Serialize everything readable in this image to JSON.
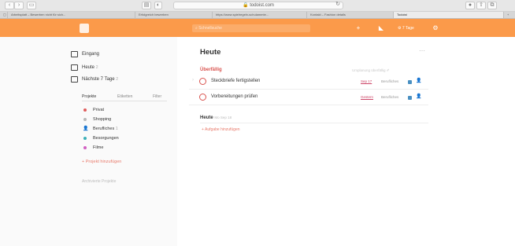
{
  "browser": {
    "url": "todoist.com",
    "tabs": [
      {
        "label": "Arbeitsplatt – Bewerben nicht für sich...",
        "active": false
      },
      {
        "label": "Erfolgreich bewerben",
        "active": false
      },
      {
        "label": "https://www.spielregeln-schulammte...",
        "active": false
      },
      {
        "label": "Kontakt – Fashion details",
        "active": false
      },
      {
        "label": "Todoist",
        "active": true
      }
    ]
  },
  "topbar": {
    "search_placeholder": "Schnellsuche",
    "karma_label": "7 Tage"
  },
  "sidebar": {
    "nav": [
      {
        "label": "Eingang",
        "icon": "inbox-icon"
      },
      {
        "label": "Heute",
        "count": "2",
        "icon": "calendar-today-icon"
      },
      {
        "label": "Nächste 7 Tage",
        "count": "2",
        "icon": "calendar-week-icon"
      }
    ],
    "tabs": [
      "Projekte",
      "Etiketten",
      "Filter"
    ],
    "projects": [
      {
        "label": "Privat",
        "color": "#e05d5d"
      },
      {
        "label": "Shopping",
        "color": "#b8b8b8"
      },
      {
        "label": "Berufliches",
        "count": "1",
        "color": "#4a90c2",
        "icon": "person-icon"
      },
      {
        "label": "Besorgungen",
        "color": "#3cb0b8"
      },
      {
        "label": "Filme",
        "color": "#d15fc2"
      }
    ],
    "add_project": "Projekt hinzufügen",
    "archived": "Archivierte Projekte"
  },
  "main": {
    "title": "Heute",
    "overdue_title": "Überfällig",
    "overdue_action": "Umplanung überfällig",
    "tasks": [
      {
        "text": "Steckbriefe fertigstellen",
        "date": "Sep 17",
        "project": "Berufliches"
      },
      {
        "text": "Vorbereitungen prüfen",
        "date": "Gestern",
        "project": "Berufliches"
      }
    ],
    "today_title": "Heute",
    "today_sub": "Mo Sep 18",
    "add_task": "Aufgabe hinzufügen"
  }
}
